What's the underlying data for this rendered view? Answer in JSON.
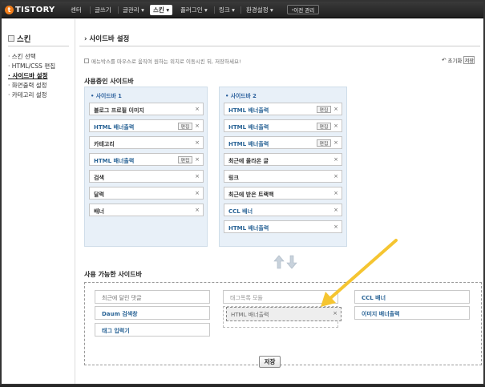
{
  "nav": {
    "logo": "TISTORY",
    "items": [
      "센터",
      "글쓰기",
      "글관리 ▾",
      "스킨 ▾",
      "플러그인 ▾",
      "링크 ▾",
      "환경설정 ▾"
    ],
    "active_index": 3,
    "admin_btn": "이전 관리"
  },
  "left": {
    "title": "스킨",
    "items": [
      "스킨 선택",
      "HTML/CSS 편집",
      "사이드바 설정",
      "화면출력 설정",
      "카테고리 설정"
    ],
    "selected_index": 2
  },
  "main": {
    "title": "사이드바 설정",
    "hint": "메뉴박스를 마우스로 움직여 원하는 위치로 이동시킨 뒤, 저장하세요!",
    "reset_label": "초기화",
    "reset_btn": "저장",
    "used_label": "사용중인 사이드바",
    "available_label": "사용 가능한 사이드바",
    "save_btn": "저장"
  },
  "sidebar1": {
    "header": "사이드바 1",
    "widgets": [
      {
        "label": "블로그 프로필 이미지",
        "blue": false,
        "edit": ""
      },
      {
        "label": "HTML 배너출력",
        "blue": true,
        "edit": "편집"
      },
      {
        "label": "카테고리",
        "blue": false,
        "edit": ""
      },
      {
        "label": "HTML 배너출력",
        "blue": true,
        "edit": "편집"
      },
      {
        "label": "검색",
        "blue": false,
        "edit": ""
      },
      {
        "label": "달력",
        "blue": false,
        "edit": ""
      },
      {
        "label": "배너",
        "blue": false,
        "edit": ""
      }
    ]
  },
  "sidebar2": {
    "header": "사이드바 2",
    "widgets": [
      {
        "label": "HTML 배너출력",
        "blue": true,
        "edit": "편집"
      },
      {
        "label": "HTML 배너출력",
        "blue": true,
        "edit": "편집"
      },
      {
        "label": "HTML 배너출력",
        "blue": true,
        "edit": "편집"
      },
      {
        "label": "최근에 올라온 글",
        "blue": false,
        "edit": ""
      },
      {
        "label": "링크",
        "blue": false,
        "edit": ""
      },
      {
        "label": "최근에 받은 트랙백",
        "blue": false,
        "edit": ""
      },
      {
        "label": "CCL 배너",
        "blue": true,
        "edit": ""
      },
      {
        "label": "HTML 배너출력",
        "blue": true,
        "edit": ""
      }
    ]
  },
  "available": {
    "col1": [
      "최근에 달린 댓글",
      "Daum 검색창",
      "태그 입력기"
    ],
    "col2": [
      "태그목록 모듈"
    ],
    "col3": [
      "CCL 배너",
      "이미지 배너출력"
    ],
    "dragging": "HTML 배너출력"
  },
  "x_glyph": "×",
  "colors": {
    "accent": "#2a6496",
    "logo": "#f07d1a",
    "arrow": "#f5c531",
    "panel": "#e8f0f8"
  }
}
